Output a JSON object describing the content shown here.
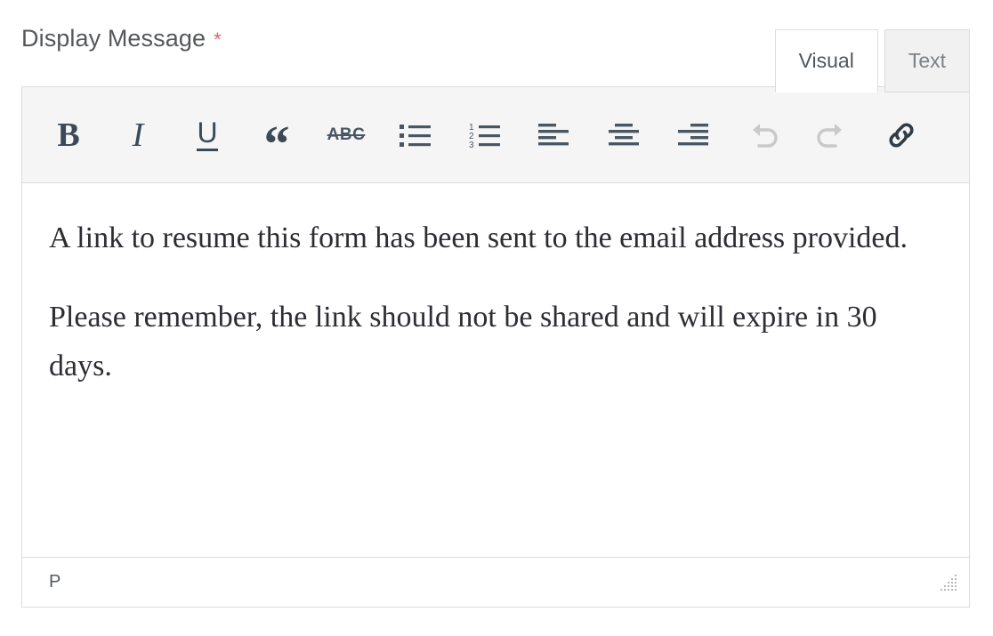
{
  "field": {
    "label": "Display Message",
    "required_marker": "*",
    "required_color": "#d9646b"
  },
  "tabs": [
    {
      "label": "Visual",
      "active": true,
      "name": "tab-visual"
    },
    {
      "label": "Text",
      "active": false,
      "name": "tab-text"
    }
  ],
  "toolbar": {
    "buttons": [
      {
        "name": "bold-icon",
        "label": "B",
        "title": "Bold",
        "state": "enabled"
      },
      {
        "name": "italic-icon",
        "label": "I",
        "title": "Italic",
        "state": "enabled"
      },
      {
        "name": "underline-icon",
        "label": "U",
        "title": "Underline",
        "state": "enabled"
      },
      {
        "name": "blockquote-icon",
        "label": "“",
        "title": "Blockquote",
        "state": "enabled"
      },
      {
        "name": "strikethrough-icon",
        "label": "ABC",
        "title": "Strikethrough",
        "state": "enabled"
      },
      {
        "name": "bulleted-list-icon",
        "label": "",
        "title": "Bulleted list",
        "state": "enabled"
      },
      {
        "name": "numbered-list-icon",
        "label": "",
        "title": "Numbered list",
        "state": "enabled"
      },
      {
        "name": "align-left-icon",
        "label": "",
        "title": "Align left",
        "state": "enabled"
      },
      {
        "name": "align-center-icon",
        "label": "",
        "title": "Align center",
        "state": "enabled"
      },
      {
        "name": "align-right-icon",
        "label": "",
        "title": "Align right",
        "state": "enabled"
      },
      {
        "name": "undo-icon",
        "label": "",
        "title": "Undo",
        "state": "disabled"
      },
      {
        "name": "redo-icon",
        "label": "",
        "title": "Redo",
        "state": "disabled"
      },
      {
        "name": "link-icon",
        "label": "",
        "title": "Insert/edit link",
        "state": "enabled"
      }
    ],
    "numbered_list_digits": [
      "1",
      "2",
      "3"
    ],
    "strikethrough_text": "ABC"
  },
  "editor_content": {
    "paragraphs": [
      "A link to resume this form has been sent to the email address provided.",
      "Please remember, the link should not be shared and will expire in 30 days."
    ]
  },
  "statusbar": {
    "element_path": "P",
    "resize_handle": "resize-grip"
  },
  "colors": {
    "toolbar_bg": "#f5f5f5",
    "border": "#dcdcdc",
    "inactive_tab_bg": "#f1f1f1",
    "label_text": "#555759",
    "body_text": "#2d2d33",
    "icon": "#4a5763",
    "icon_disabled": "#c9c9c9"
  }
}
